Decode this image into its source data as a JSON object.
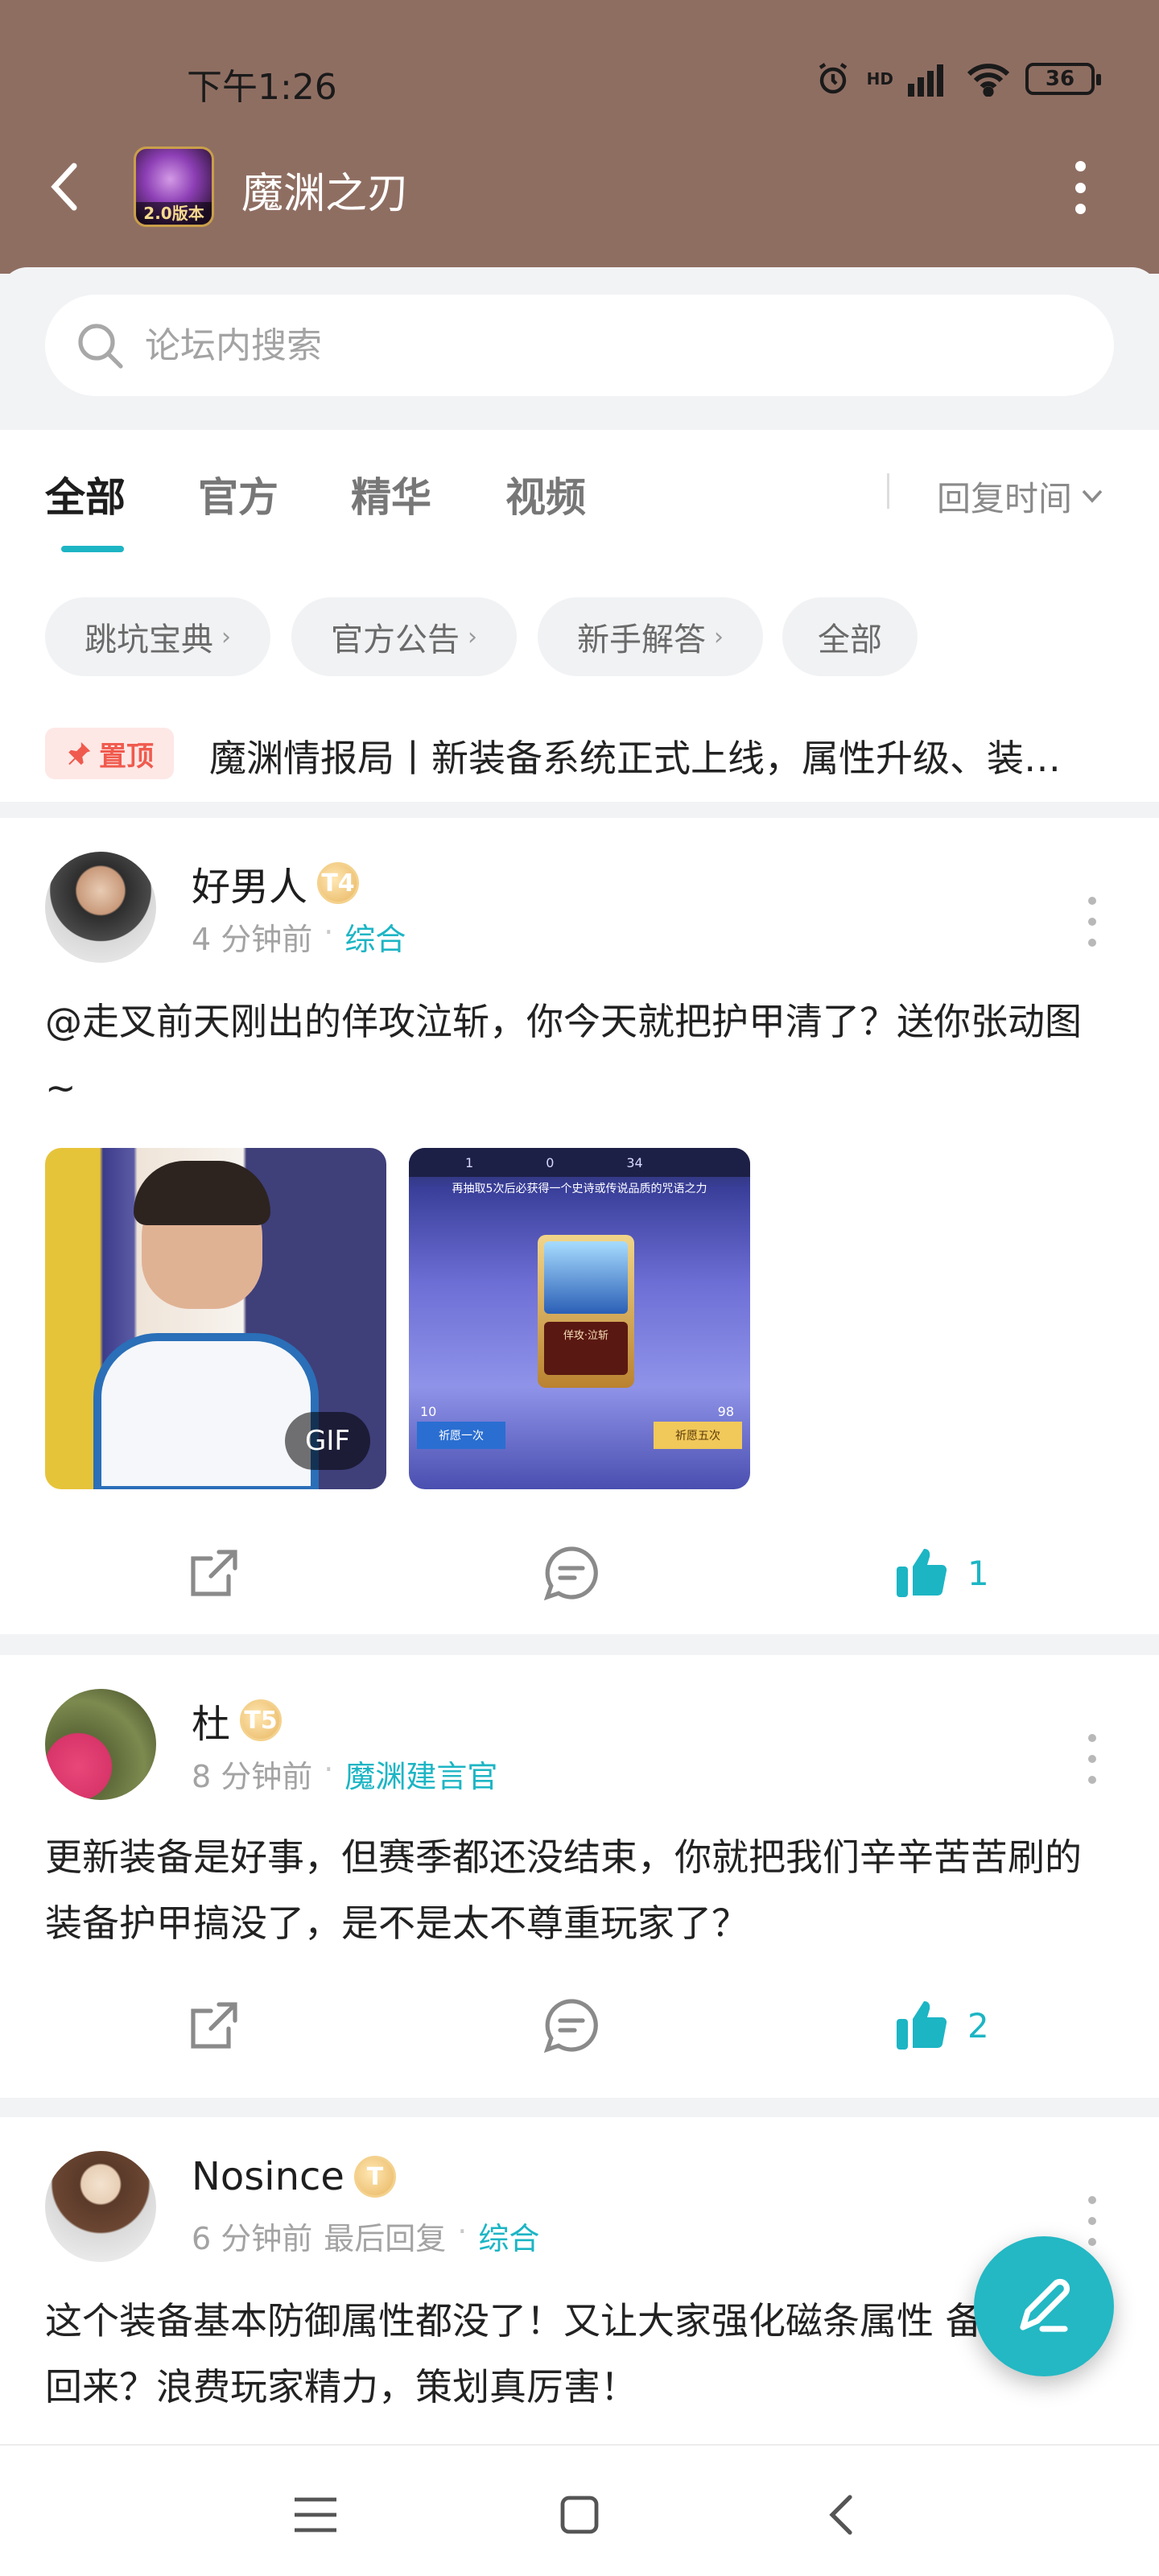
{
  "status_bar": {
    "time": "下午1:26",
    "battery": "36",
    "network": "HD"
  },
  "header": {
    "forum_title": "魔渊之刃",
    "game_icon_badge": "2.0版本"
  },
  "search": {
    "placeholder": "论坛内搜索"
  },
  "tabs": [
    {
      "label": "全部",
      "active": true
    },
    {
      "label": "官方",
      "active": false
    },
    {
      "label": "精华",
      "active": false
    },
    {
      "label": "视频",
      "active": false
    }
  ],
  "sort": {
    "label": "回复时间"
  },
  "chips": [
    {
      "label": "跳坑宝典",
      "has_arrow": true
    },
    {
      "label": "官方公告",
      "has_arrow": true
    },
    {
      "label": "新手解答",
      "has_arrow": true
    },
    {
      "label": "全部",
      "has_arrow": false
    }
  ],
  "pinned": {
    "badge": "置顶",
    "text": "魔渊情报局丨新装备系统正式上线，属性升级、装…"
  },
  "posts": [
    {
      "author": "好男人",
      "level": "T4",
      "time": "4 分钟前",
      "category": "综合",
      "body": "@走叉前天刚出的佯攻泣斩，你今天就把护甲清了？送你张动图 ~",
      "images": [
        {
          "type": "gif",
          "tag": "GIF"
        },
        {
          "type": "screenshot",
          "title": "再抽取5次后必获得一个史诗或传说品质的咒语之力",
          "card": "佯攻·泣斩",
          "top_values": [
            "1",
            "0",
            "34"
          ],
          "left_count": "10",
          "right_count": "98",
          "btn_left": "祈愿一次",
          "btn_right": "祈愿五次"
        }
      ],
      "likes": "1"
    },
    {
      "author": "杜",
      "level": "T5",
      "time": "8 分钟前",
      "category": "魔渊建言官",
      "body": "更新装备是好事，但赛季都还没结束，你就把我们辛辛苦苦刷的装备护甲搞没了，是不是太不尊重玩家了？",
      "likes": "2"
    },
    {
      "author": "Nosince",
      "level": "T",
      "time": "6 分钟前",
      "last_reply": "最后回复",
      "category": "综合",
      "body": "这个装备基本防御属性都没了！又让大家强化磁条属性 备！再加回来？浪费玩家精力，策划真厉害！"
    }
  ],
  "colors": {
    "accent": "#1cb5c4",
    "header_bg": "#8f6e62",
    "pin_red": "#f05a4e",
    "fab": "#23b8c4"
  },
  "icons": [
    "back-icon",
    "more-vertical-icon",
    "search-icon",
    "chevron-down-icon",
    "pin-icon",
    "share-icon",
    "comment-icon",
    "thumbs-up-icon",
    "edit-icon",
    "menu-icon",
    "home-icon",
    "back-nav-icon"
  ]
}
